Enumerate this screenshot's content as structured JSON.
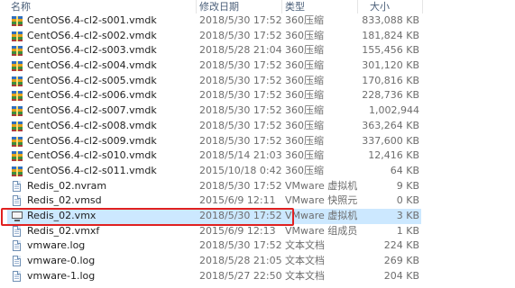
{
  "columns": {
    "name": "名称",
    "date": "修改日期",
    "type": "类型",
    "size": "大小"
  },
  "files": [
    {
      "name": "CentOS6.4-cl2-s001.vmdk",
      "date": "2018/5/30 17:52",
      "type": "360压缩",
      "size": "833,088 KB",
      "icon": "vmdk-archive-icon"
    },
    {
      "name": "CentOS6.4-cl2-s002.vmdk",
      "date": "2018/5/30 17:52",
      "type": "360压缩",
      "size": "181,824 KB",
      "icon": "vmdk-archive-icon"
    },
    {
      "name": "CentOS6.4-cl2-s003.vmdk",
      "date": "2018/5/28 21:04",
      "type": "360压缩",
      "size": "155,456 KB",
      "icon": "vmdk-archive-icon"
    },
    {
      "name": "CentOS6.4-cl2-s004.vmdk",
      "date": "2018/5/30 17:52",
      "type": "360压缩",
      "size": "301,120 KB",
      "icon": "vmdk-archive-icon"
    },
    {
      "name": "CentOS6.4-cl2-s005.vmdk",
      "date": "2018/5/30 17:52",
      "type": "360压缩",
      "size": "170,816 KB",
      "icon": "vmdk-archive-icon"
    },
    {
      "name": "CentOS6.4-cl2-s006.vmdk",
      "date": "2018/5/30 17:52",
      "type": "360压缩",
      "size": "228,736 KB",
      "icon": "vmdk-archive-icon"
    },
    {
      "name": "CentOS6.4-cl2-s007.vmdk",
      "date": "2018/5/30 17:52",
      "type": "360压缩",
      "size": "1,002,944",
      "icon": "vmdk-archive-icon"
    },
    {
      "name": "CentOS6.4-cl2-s008.vmdk",
      "date": "2018/5/30 17:52",
      "type": "360压缩",
      "size": "363,264 KB",
      "icon": "vmdk-archive-icon"
    },
    {
      "name": "CentOS6.4-cl2-s009.vmdk",
      "date": "2018/5/30 17:52",
      "type": "360压缩",
      "size": "337,600 KB",
      "icon": "vmdk-archive-icon"
    },
    {
      "name": "CentOS6.4-cl2-s010.vmdk",
      "date": "2018/5/14 21:03",
      "type": "360压缩",
      "size": "12,416 KB",
      "icon": "vmdk-archive-icon"
    },
    {
      "name": "CentOS6.4-cl2-s011.vmdk",
      "date": "2015/10/18 0:42",
      "type": "360压缩",
      "size": "64 KB",
      "icon": "vmdk-archive-icon"
    },
    {
      "name": "Redis_02.nvram",
      "date": "2018/5/30 17:52",
      "type": "VMware 虚拟机...",
      "size": "9 KB",
      "icon": "document-icon"
    },
    {
      "name": "Redis_02.vmsd",
      "date": "2015/6/9 12:11",
      "type": "VMware 快照元...",
      "size": "0 KB",
      "icon": "document-icon"
    },
    {
      "name": "Redis_02.vmx",
      "date": "2018/5/30 17:52",
      "type": "VMware 虚拟机",
      "size": "3 KB",
      "icon": "vm-config-icon",
      "selected": true
    },
    {
      "name": "Redis_02.vmxf",
      "date": "2015/6/9 12:13",
      "type": "VMware 组成员",
      "size": "1 KB",
      "icon": "document-icon"
    },
    {
      "name": "vmware.log",
      "date": "2018/5/30 17:52",
      "type": "文本文档",
      "size": "224 KB",
      "icon": "document-icon"
    },
    {
      "name": "vmware-0.log",
      "date": "2018/5/28 21:05",
      "type": "文本文档",
      "size": "269 KB",
      "icon": "document-icon"
    },
    {
      "name": "vmware-1.log",
      "date": "2018/5/27 22:50",
      "type": "文本文档",
      "size": "204 KB",
      "icon": "document-icon"
    }
  ],
  "highlight_color": "#e02020",
  "selection_color": "#cce8ff"
}
